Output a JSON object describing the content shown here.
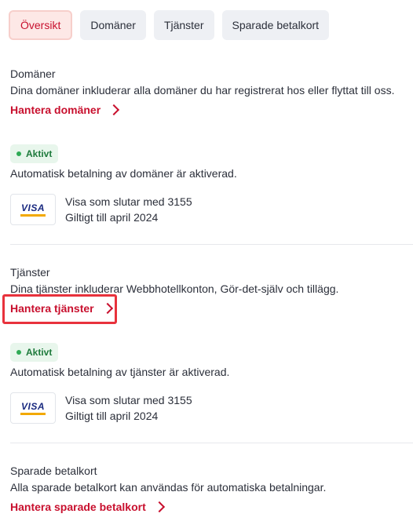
{
  "tabs": [
    {
      "label": "Översikt"
    },
    {
      "label": "Domäner"
    },
    {
      "label": "Tjänster"
    },
    {
      "label": "Sparade betalkort"
    }
  ],
  "domains": {
    "title": "Domäner",
    "description": "Dina domäner inkluderar alla domäner du har registrerat hos eller flyttat till oss.",
    "link": "Hantera domäner",
    "badge": "Aktivt",
    "status": "Automatisk betalning av domäner är aktiverad.",
    "card_brand": "VISA",
    "card_line1": "Visa som slutar med 3155",
    "card_line2": "Giltigt till april 2024"
  },
  "services": {
    "title": "Tjänster",
    "description": "Dina tjänster inkluderar Webbhotellkonton, Gör-det-själv och tillägg.",
    "link": "Hantera tjänster",
    "badge": "Aktivt",
    "status": "Automatisk betalning av tjänster är aktiverad.",
    "card_brand": "VISA",
    "card_line1": "Visa som slutar med 3155",
    "card_line2": "Giltigt till april 2024"
  },
  "saved_cards": {
    "title": "Sparade betalkort",
    "description": "Alla sparade betalkort kan användas för automatiska betalningar.",
    "link": "Hantera sparade betalkort"
  },
  "colors": {
    "accent": "#c8102e",
    "active_badge_bg": "#e8f6ec",
    "highlight_outline": "#e8323c"
  }
}
